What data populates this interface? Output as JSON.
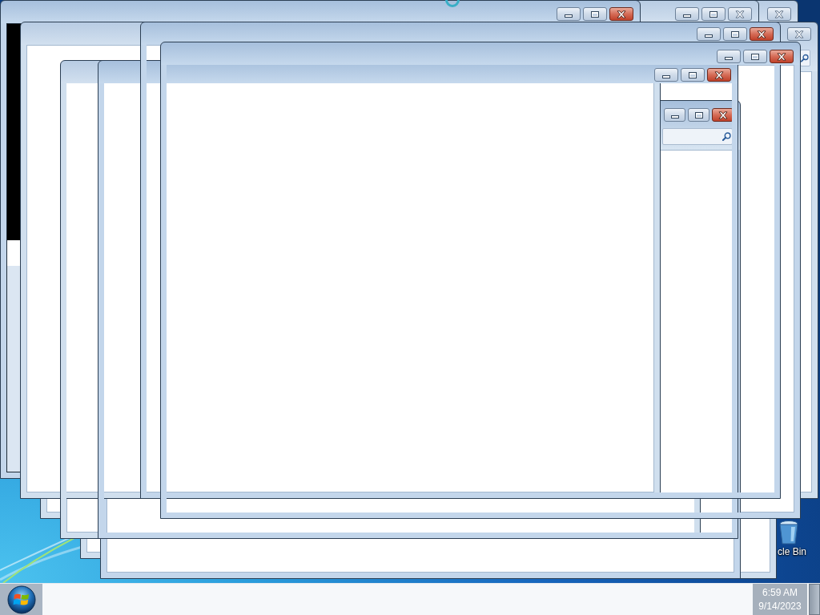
{
  "windows": [
    {
      "kind": "plain",
      "active": false
    },
    {
      "kind": "plain",
      "active": false
    },
    {
      "kind": "search",
      "active": false
    },
    {
      "kind": "plain",
      "active": false
    },
    {
      "kind": "plain",
      "active": false
    },
    {
      "kind": "plain",
      "active": false
    },
    {
      "kind": "console",
      "active": true
    },
    {
      "kind": "plain",
      "active": true
    },
    {
      "kind": "plain",
      "active": false
    },
    {
      "kind": "plain",
      "active": true
    },
    {
      "kind": "plain",
      "active": true
    },
    {
      "kind": "search",
      "active": true
    },
    {
      "kind": "plain",
      "active": false
    }
  ],
  "desktop_icons": [
    {
      "label": "cle Bin"
    }
  ],
  "taskbar": {
    "clock": {
      "time": "6:59 AM",
      "date": "9/14/2023"
    }
  }
}
